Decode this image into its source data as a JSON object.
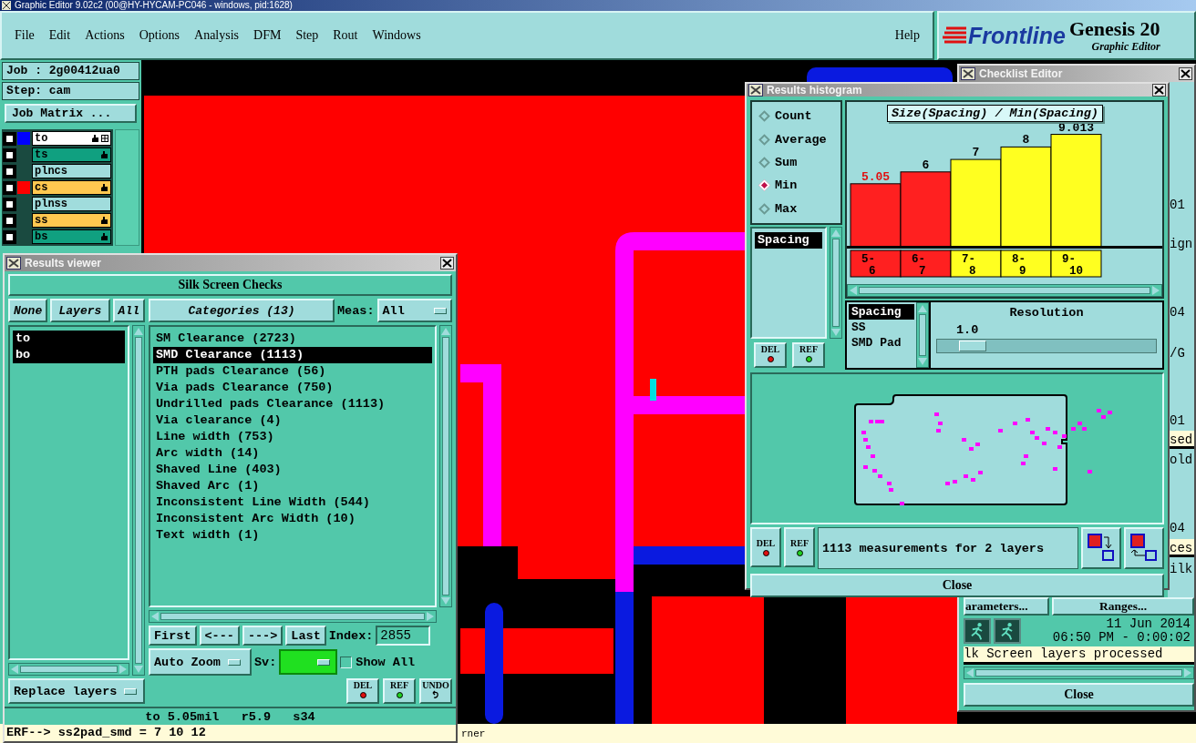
{
  "title_bar": {
    "title": "Graphic Editor 9.02c2 (00@HY-HYCAM-PC046 - windows, pid:1628)"
  },
  "menu": [
    "File",
    "Edit",
    "Actions",
    "Options",
    "Analysis",
    "DFM",
    "Step",
    "Rout",
    "Windows"
  ],
  "help": "Help",
  "logo": {
    "brand": "Frontline",
    "product": "Genesis 20",
    "subtitle": "Graphic Editor"
  },
  "job_panel": {
    "job": "Job : 2g00412ua0",
    "step": "Step: cam",
    "matrix_button": "Job Matrix ...",
    "layers": [
      {
        "name": "to",
        "checked": false,
        "color": "#ffffff",
        "swatch": {
          "color": "#0000ff"
        },
        "affected": true,
        "active": true
      },
      {
        "name": "ts",
        "checked": false,
        "color": "#10a080",
        "affected": true,
        "active": false
      },
      {
        "name": "plncs",
        "checked": false,
        "color": "#a0dcdc",
        "affected": false,
        "active": false
      },
      {
        "name": "cs",
        "checked": false,
        "color": "#ffc850",
        "swatch": {
          "color": "#ff0000"
        },
        "affected": true,
        "active": false
      },
      {
        "name": "plnss",
        "checked": false,
        "color": "#a0dcdc",
        "affected": false,
        "active": false
      },
      {
        "name": "ss",
        "checked": false,
        "color": "#ffc850",
        "affected": true,
        "active": false
      },
      {
        "name": "bs",
        "checked": false,
        "color": "#10a080",
        "affected": true,
        "active": false
      }
    ]
  },
  "status_line": {
    "text": "rner"
  },
  "results_viewer": {
    "title": "Results viewer",
    "header": "Silk Screen Checks",
    "layer_buttons": [
      "None",
      "Layers",
      "All"
    ],
    "layers": [
      {
        "name": "to",
        "selected": true
      },
      {
        "name": "bo",
        "selected": true
      }
    ],
    "categories_button": "Categories (13)",
    "meas_label": "Meas:",
    "meas_value": "All",
    "categories": [
      {
        "label": "SM Clearance (2723)",
        "selected": false
      },
      {
        "label": "SMD Clearance (1113)",
        "selected": true
      },
      {
        "label": "PTH pads Clearance (56)",
        "selected": false
      },
      {
        "label": "Via pads Clearance (750)",
        "selected": false
      },
      {
        "label": "Undrilled pads Clearance (1113)",
        "selected": false
      },
      {
        "label": "Via clearance (4)",
        "selected": false
      },
      {
        "label": "Line width (753)",
        "selected": false
      },
      {
        "label": "Arc width (14)",
        "selected": false
      },
      {
        "label": "Shaved Line (403)",
        "selected": false
      },
      {
        "label": "Shaved Arc (1)",
        "selected": false
      },
      {
        "label": "Inconsistent Line Width (544)",
        "selected": false
      },
      {
        "label": "Inconsistent Arc Width (10)",
        "selected": false
      },
      {
        "label": "Text width (1)",
        "selected": false
      }
    ],
    "nav_buttons": [
      "First",
      "<---",
      "--->",
      "Last"
    ],
    "index_label": "Index:",
    "index_value": "2855",
    "zoom_mode": "Auto Zoom",
    "sv_label": "Sv:",
    "show_all": {
      "label": "Show All",
      "checked": false
    },
    "replace_mode": "Replace layers",
    "tool_buttons": [
      {
        "label": "DEL",
        "kind": "delete"
      },
      {
        "label": "REF",
        "kind": "refresh"
      },
      {
        "label": "UNDO",
        "kind": "undo"
      }
    ],
    "measure": "to 5.05mil   r5.9   s34",
    "erf": "ERF--> ss2pad_smd = 7 10 12"
  },
  "histogram": {
    "title": "Results histogram",
    "modes": [
      {
        "label": "Count",
        "selected": false
      },
      {
        "label": "Average",
        "selected": false
      },
      {
        "label": "Sum",
        "selected": false
      },
      {
        "label": "Min",
        "selected": true
      },
      {
        "label": "Max",
        "selected": false
      }
    ],
    "metrics": [
      {
        "label": "Spacing",
        "selected": true
      }
    ],
    "tool_buttons": [
      {
        "label": "DEL",
        "kind": "delete"
      },
      {
        "label": "REF",
        "kind": "refresh"
      }
    ],
    "chart_data": {
      "type": "bar",
      "title": "Size(Spacing) / Min(Spacing)",
      "categories": [
        "5-6",
        "6-7",
        "7-8",
        "8-9",
        "9-10"
      ],
      "values": [
        5.05,
        6,
        7,
        8,
        9.013
      ],
      "data_labels": true
    },
    "bins": [
      {
        "color": "#ff2020"
      },
      {
        "color": "#ff2020"
      },
      {
        "color": "#ffff20"
      },
      {
        "color": "#ffff20"
      },
      {
        "color": "#ffff20"
      }
    ],
    "features": [
      {
        "label": "Spacing",
        "selected": true
      },
      {
        "label": "SS",
        "selected": false
      },
      {
        "label": "SMD Pad",
        "selected": false
      }
    ],
    "resolution": {
      "label": "Resolution",
      "value": "1.0",
      "level": 0.1
    },
    "map_tool_buttons": [
      {
        "label": "DEL",
        "kind": "delete"
      },
      {
        "label": "REF",
        "kind": "refresh"
      }
    ],
    "summary": "1113 measurements for 2 layers",
    "close": "Close"
  },
  "checklist_editor": {
    "title": "Checklist Editor",
    "side_texts": [
      {
        "text": "01",
        "kind": "label"
      },
      {
        "text": "ign",
        "kind": "label"
      },
      {
        "text": "04",
        "kind": "label"
      },
      {
        "text": "/G",
        "kind": "label"
      },
      {
        "text": "01",
        "kind": "label"
      },
      {
        "text": "sed",
        "kind": "field"
      },
      {
        "text": "old",
        "kind": "label"
      },
      {
        "text": "04",
        "kind": "label"
      },
      {
        "text": "ces",
        "kind": "field"
      },
      {
        "text": "ilk",
        "kind": "label"
      }
    ],
    "buttons": [
      "arameters...",
      "Ranges..."
    ],
    "date": "11 Jun 2014",
    "time": "06:50 PM - 0:00:02",
    "status": "lk Screen layers processed",
    "close": "Close"
  }
}
